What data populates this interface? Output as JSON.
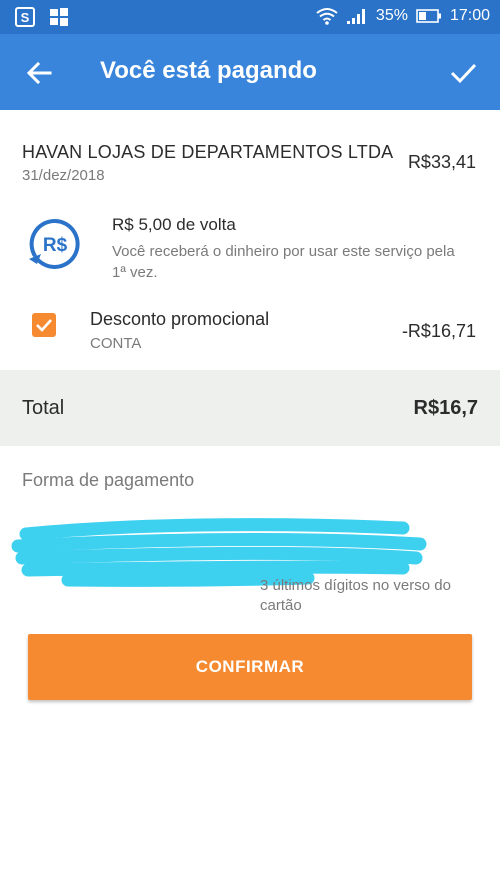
{
  "status_bar": {
    "battery": "35%",
    "time": "17:00",
    "icons": [
      "app-s-icon",
      "windows-icon",
      "wifi-icon",
      "signal-icon",
      "battery-icon"
    ]
  },
  "app_bar": {
    "title": "Você está pagando",
    "back_icon": "arrow-left-icon",
    "confirm_icon": "check-icon",
    "color": "#3a85dc"
  },
  "merchant": {
    "name": "HAVAN LOJAS DE DEPARTAMENTOS LTDA",
    "date": "31/dez/2018",
    "amount": "R$33,41"
  },
  "cashback": {
    "icon_text": "R$",
    "title": "R$ 5,00 de volta",
    "description": "Você receberá o dinheiro por usar este serviço pela 1ª vez.",
    "accent": "#2a73c8"
  },
  "promo": {
    "checked": true,
    "label": "Desconto promocional",
    "sub": "CONTA",
    "amount": "-R$16,71",
    "accent": "#f68a31"
  },
  "total": {
    "label": "Total",
    "value": "R$16,7"
  },
  "payment": {
    "header": "Forma de pagamento",
    "cvv_hint": "3 últimos dígitos no verso do cartão"
  },
  "confirm": {
    "label": "CONFIRMAR",
    "color": "#f68a31"
  }
}
